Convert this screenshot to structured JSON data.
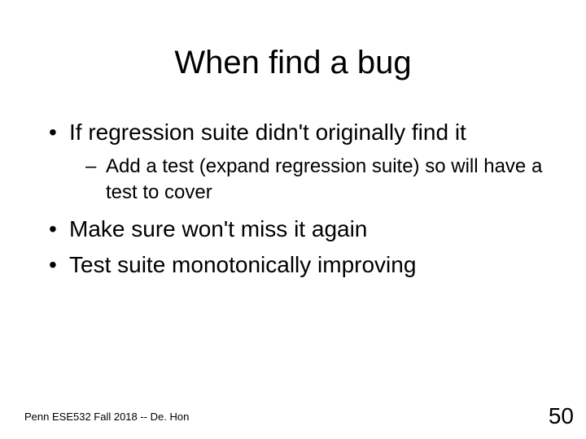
{
  "slide": {
    "title": "When find a bug",
    "bullets": {
      "b1": "If regression suite didn't originally find it",
      "b1_sub": "Add a test (expand regression suite) so will have a test to cover",
      "b2": "Make sure won't miss it again",
      "b3": "Test suite monotonically improving"
    },
    "footer_left": "Penn ESE532 Fall 2018 -- De. Hon",
    "footer_right": "50"
  }
}
